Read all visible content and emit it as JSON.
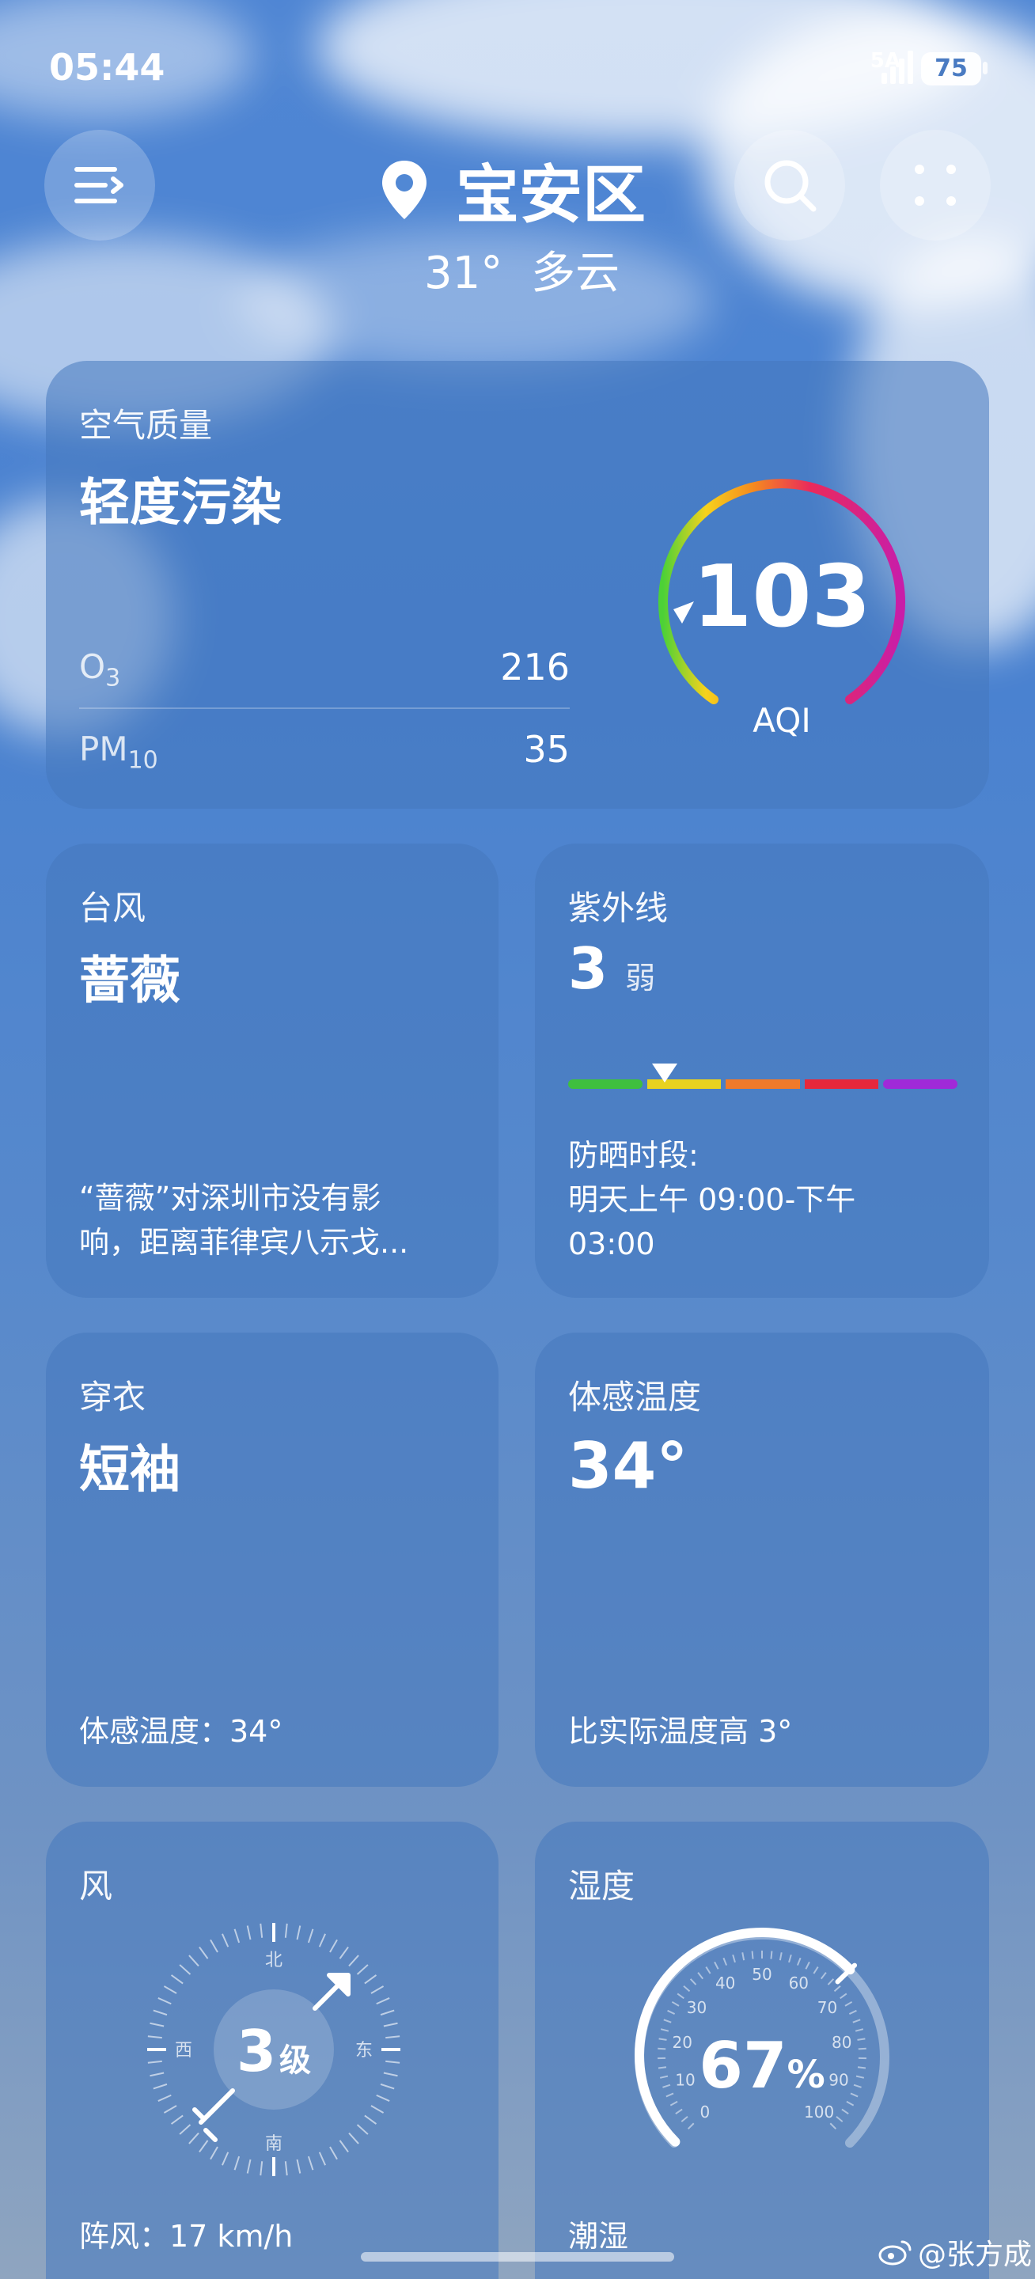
{
  "status": {
    "time": "05:44",
    "network": "5A",
    "battery": "75"
  },
  "header": {
    "location": "宝安区",
    "temperature": "31°",
    "condition": "多云"
  },
  "air_quality": {
    "title": "空气质量",
    "level": "轻度污染",
    "pollutants": [
      {
        "name": "O",
        "sub": "3",
        "value": "216"
      },
      {
        "name": "PM",
        "sub": "10",
        "value": "35"
      }
    ],
    "aqi": "103",
    "aqi_label": "AQI",
    "gauge_fraction": 0.2
  },
  "typhoon": {
    "title": "台风",
    "name": "蔷薇",
    "line1": "“蔷薇”对深圳市没有影",
    "line2": "响，距离菲律宾八示戈..."
  },
  "uv": {
    "title": "紫外线",
    "value": "3",
    "level": "弱",
    "sunscreen_label": "防晒时段:",
    "sunscreen_line1": "明天上午 09:00-下午",
    "sunscreen_line2": "03:00"
  },
  "clothing": {
    "title": "穿衣",
    "value": "短袖",
    "footer": "体感温度：34°"
  },
  "feels_like": {
    "title": "体感温度",
    "value": "34°",
    "footer": "比实际温度高 3°"
  },
  "wind": {
    "title": "风",
    "level_num": "3",
    "level_unit": "级",
    "north": "北",
    "south": "南",
    "east": "东",
    "west": "西",
    "gust": "阵风：17 km/h"
  },
  "humidity": {
    "title": "湿度",
    "value": "67",
    "unit": "%",
    "ticks": [
      "0",
      "10",
      "20",
      "30",
      "40",
      "50",
      "60",
      "70",
      "80",
      "90",
      "100"
    ],
    "footer": "潮湿"
  },
  "watermark": "@张方成",
  "colors": {
    "card": "#4678be",
    "uv_bar": [
      "#3fbf3f",
      "#e8d21f",
      "#f07a2a",
      "#e6283c",
      "#a02ad8"
    ]
  }
}
